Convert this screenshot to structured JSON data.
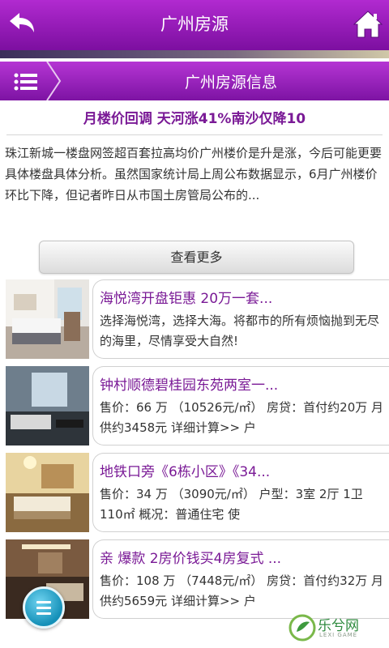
{
  "header": {
    "title": "广州房源"
  },
  "section": {
    "heading": "广州房源信息"
  },
  "news": {
    "title": "月楼价回调 天河涨41%南沙仅降10",
    "body": "珠江新城一楼盘网签超百套拉高均价广州楼价是升是涨，今后可能更要具体楼盘具体分析。虽然国家统计局上周公布数据显示，6月广州楼价环比下降，但记者昨日从市国土房管局公布的...",
    "more_label": "查看更多"
  },
  "listings": [
    {
      "title": "海悦湾开盘钜惠 20万一套...",
      "desc": "选择海悦湾，选择大海。将都市的所有烦恼抛到无尽的海里，尽情享受大自然!"
    },
    {
      "title": "钟村顺德碧桂园东苑两室一...",
      "desc": "售价：66 万 （10526元/㎡） 房贷：首付约20万 月供约3458元 详细计算>> 户"
    },
    {
      "title": "地铁口旁《6栋小区》《34...",
      "desc": "售价：34 万 （3090元/㎡） 户型：3室 2厅 1卫　 110㎡ 概况：普通住宅 使"
    },
    {
      "title": "亲 爆款 2房价钱买4房复式 ...",
      "desc": "售价：108 万 （7448元/㎡） 房贷：首付约32万 月供约5659元 详细计算>> 户"
    }
  ],
  "watermark": {
    "text": "乐兮网",
    "sub": "LEXI GAME"
  },
  "icons": {
    "back": "back-arrow-icon",
    "home": "home-icon",
    "menu": "list-menu-icon",
    "float": "floating-menu-icon",
    "logo": "lexi-logo-icon"
  },
  "colors": {
    "brand": "#8e1bb4",
    "title_text": "#7a1a96",
    "float_button": "#1490b8"
  }
}
